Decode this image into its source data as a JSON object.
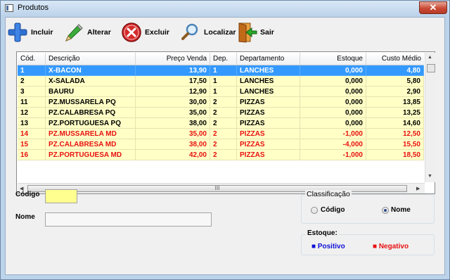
{
  "window": {
    "title": "Produtos",
    "close_label": "✕"
  },
  "toolbar": {
    "incluir": "Incluir",
    "alterar": "Alterar",
    "excluir": "Excluir",
    "localizar": "Localizar",
    "sair": "Sair"
  },
  "grid": {
    "columns": [
      "Cód.",
      "Descrição",
      "Preço Venda",
      "Dep.",
      "Departamento",
      "Estoque",
      "Custo Médio"
    ],
    "rows": [
      {
        "cod": "1",
        "desc": "X-BACON",
        "preco": "13,90",
        "dep": "1",
        "depto": "LANCHES",
        "estoque": "0,000",
        "custo": "4,80",
        "state": "selected"
      },
      {
        "cod": "2",
        "desc": "X-SALADA",
        "preco": "17,50",
        "dep": "1",
        "depto": "LANCHES",
        "estoque": "0,000",
        "custo": "5,80",
        "state": "positive"
      },
      {
        "cod": "3",
        "desc": "BAURU",
        "preco": "12,90",
        "dep": "1",
        "depto": "LANCHES",
        "estoque": "0,000",
        "custo": "2,90",
        "state": "positive"
      },
      {
        "cod": "11",
        "desc": "PZ.MUSSARELA PQ",
        "preco": "30,00",
        "dep": "2",
        "depto": "PIZZAS",
        "estoque": "0,000",
        "custo": "13,85",
        "state": "positive"
      },
      {
        "cod": "12",
        "desc": "PZ.CALABRESA PQ",
        "preco": "35,00",
        "dep": "2",
        "depto": "PIZZAS",
        "estoque": "0,000",
        "custo": "13,25",
        "state": "positive"
      },
      {
        "cod": "13",
        "desc": "PZ.PORTUGUESA PQ",
        "preco": "38,00",
        "dep": "2",
        "depto": "PIZZAS",
        "estoque": "0,000",
        "custo": "14,60",
        "state": "positive"
      },
      {
        "cod": "14",
        "desc": "PZ.MUSSARELA MD",
        "preco": "35,00",
        "dep": "2",
        "depto": "PIZZAS",
        "estoque": "-1,000",
        "custo": "12,50",
        "state": "negative"
      },
      {
        "cod": "15",
        "desc": "PZ.CALABRESA MD",
        "preco": "38,00",
        "dep": "2",
        "depto": "PIZZAS",
        "estoque": "-4,000",
        "custo": "15,50",
        "state": "negative"
      },
      {
        "cod": "16",
        "desc": "PZ.PORTUGUESA MD",
        "preco": "42,00",
        "dep": "2",
        "depto": "PIZZAS",
        "estoque": "-1,000",
        "custo": "18,50",
        "state": "negative"
      }
    ],
    "hscroll_grip": "III"
  },
  "form": {
    "codigo_label": "Código",
    "codigo_value": "",
    "nome_label": "Nome",
    "nome_value": ""
  },
  "classificacao": {
    "title": "Classificação",
    "options": [
      "Código",
      "Nome"
    ],
    "selected": "Nome"
  },
  "estoque": {
    "title": "Estoque:",
    "positivo": "Positivo",
    "negativo": "Negativo"
  },
  "colors": {
    "selected_bg": "#3399ff",
    "row_bg": "#ffffc6",
    "positive_text": "#000000",
    "negative_text": "#e81010",
    "legend_positive": "#1010d8",
    "legend_negative": "#e81010",
    "codigo_field_bg": "#ffff90"
  }
}
